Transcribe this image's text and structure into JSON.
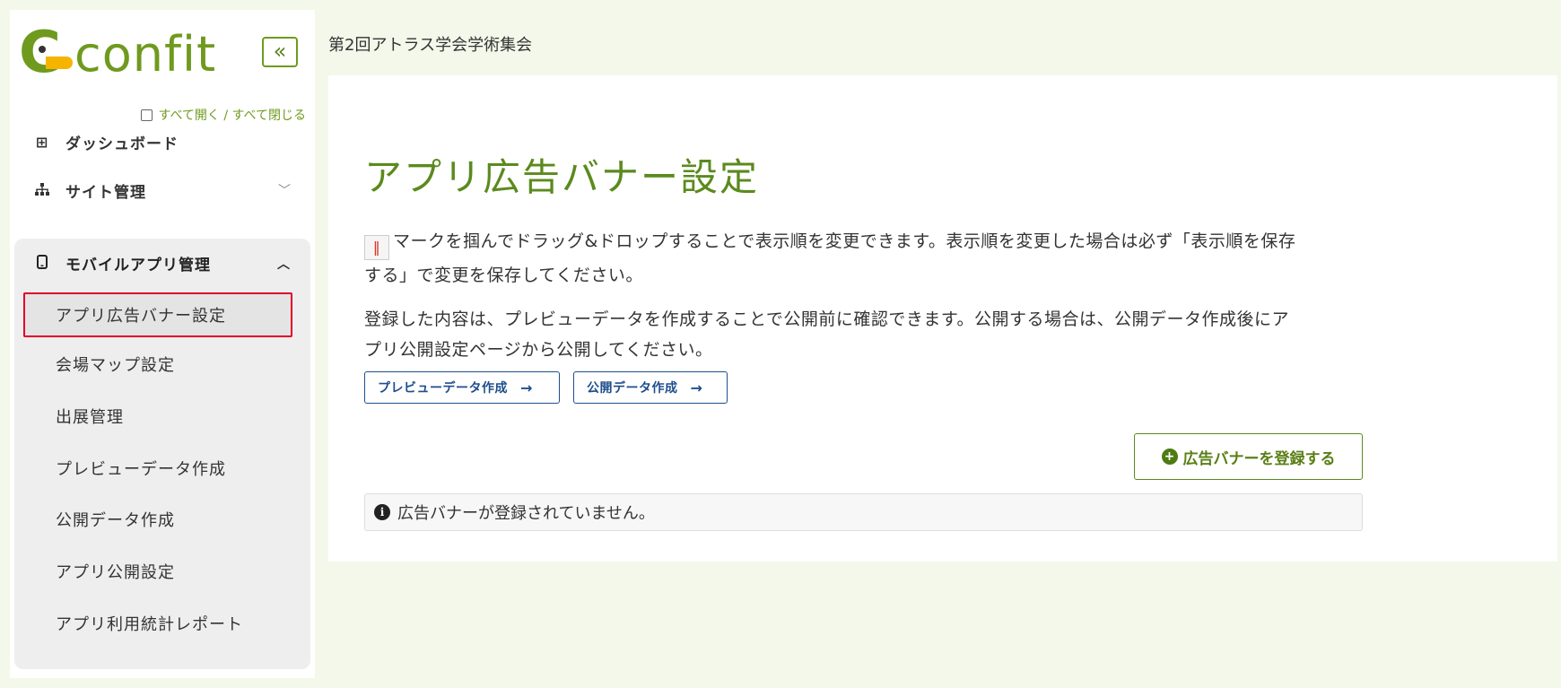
{
  "app": {
    "logo_text": "confit",
    "collapse_label": "«",
    "conference_title": "第2回アトラス学会学術集会"
  },
  "sidebar": {
    "toggle_all": "すべて開く / すべて閉じる",
    "items": [
      {
        "label": "ダッシュボード",
        "icon": "table-icon"
      },
      {
        "label": "サイト管理",
        "icon": "sitemap-icon",
        "chevron": "﹀"
      }
    ],
    "group": {
      "label": "モバイルアプリ管理",
      "icon": "mobile-icon",
      "chevron": "︿",
      "sub_items": [
        {
          "label": "アプリ広告バナー設定",
          "active": true
        },
        {
          "label": "会場マップ設定"
        },
        {
          "label": "出展管理"
        },
        {
          "label": "プレビューデータ作成"
        },
        {
          "label": "公開データ作成"
        },
        {
          "label": "アプリ公開設定"
        },
        {
          "label": "アプリ利用統計レポート"
        }
      ]
    }
  },
  "main": {
    "title": "アプリ広告バナー設定",
    "para1_mark": "‖",
    "para1_line1": "マークを掴んでドラッグ&ドロップすることで表示順を変更できます。表示順を変更した場合は必ず「表示順を保存",
    "para1_line2": "する」で変更を保存してください。",
    "para2_line1": "登録した内容は、プレビューデータを作成することで公開前に確認できます。公開する場合は、公開データ作成後にア",
    "para2_line2": "プリ公開設定ページから公開してください。",
    "buttons": {
      "preview": "プレビューデータ作成",
      "publish": "公開データ作成",
      "arrow": "→",
      "register": "広告バナーを登録する",
      "register_icon": "+"
    },
    "notice": "広告バナーが登録されていません。",
    "notice_icon": "i"
  },
  "colors": {
    "brand_green": "#5b8a1e",
    "link_blue": "#1f4e8c",
    "active_border": "#e0002a",
    "background": "#f3f8ea"
  }
}
